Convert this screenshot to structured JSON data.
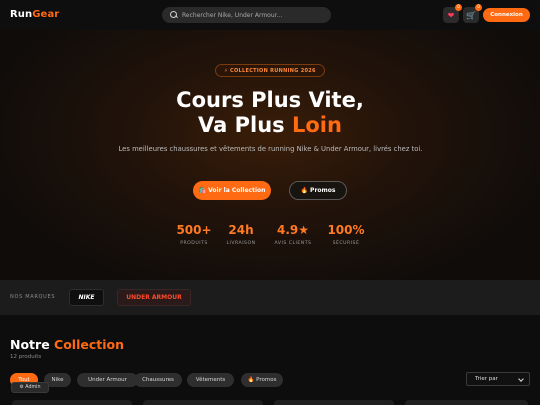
{
  "brand": {
    "name_a": "Run",
    "name_b": "Gear"
  },
  "search": {
    "placeholder": "Rechercher Nike, Under Armour..."
  },
  "header": {
    "wishlist_count": "0",
    "cart_count": "0",
    "login_label": "Connexion",
    "wishlist_icon": "heart-icon",
    "cart_icon": "cart-icon"
  },
  "colors": {
    "accent": "#ff6a13",
    "background": "#0d0d0d"
  },
  "hero": {
    "tag": "⚡ COLLECTION RUNNING 2026",
    "title_line1": "Cours Plus Vite,",
    "title_line2_a": "Va Plus ",
    "title_line2_b": "Loin",
    "subtitle": "Les meilleures chaussures et vêtements de running Nike & Under Armour, livrés chez toi.",
    "cta_primary": "🛍️ Voir la Collection",
    "cta_secondary": "🔥 Promos",
    "stats": [
      {
        "value": "500+",
        "label": "PRODUITS"
      },
      {
        "value": "24h",
        "label": "LIVRAISON"
      },
      {
        "value": "4.9★",
        "label": "AVIS CLIENTS"
      },
      {
        "value": "100%",
        "label": "SÉCURISÉ"
      }
    ]
  },
  "brands": {
    "label": "NOS MARQUES",
    "items": [
      "NIKE",
      "UNDER ARMOUR"
    ]
  },
  "collection": {
    "title_a": "Notre ",
    "title_b": "Collection",
    "count": "12 produits",
    "filters": [
      "Tout",
      "Nike",
      "Under Armour",
      "Chaussures",
      "Vêtements",
      "🔥 Promos"
    ],
    "sort_label": "Trier par",
    "admin_label": "⚙ Admin"
  }
}
